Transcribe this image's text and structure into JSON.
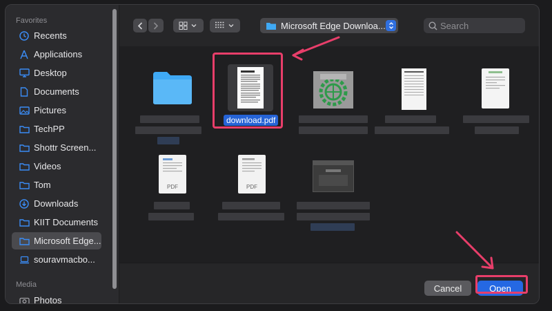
{
  "sidebar": {
    "favorites_label": "Favorites",
    "items": [
      {
        "label": "Recents",
        "icon": "clock-icon"
      },
      {
        "label": "Applications",
        "icon": "applications-icon"
      },
      {
        "label": "Desktop",
        "icon": "desktop-icon"
      },
      {
        "label": "Documents",
        "icon": "document-icon"
      },
      {
        "label": "Pictures",
        "icon": "pictures-icon"
      },
      {
        "label": "TechPP",
        "icon": "folder-icon"
      },
      {
        "label": "Shottr Screen...",
        "icon": "folder-icon"
      },
      {
        "label": "Videos",
        "icon": "folder-icon"
      },
      {
        "label": "Tom",
        "icon": "folder-icon"
      },
      {
        "label": "Downloads",
        "icon": "download-icon"
      },
      {
        "label": "KIIT Documents",
        "icon": "folder-icon"
      },
      {
        "label": "Microsoft Edge...",
        "icon": "folder-icon",
        "selected": true
      },
      {
        "label": "souravmacbo...",
        "icon": "laptop-icon"
      }
    ],
    "media_label": "Media",
    "media_items": [
      {
        "label": "Photos",
        "icon": "camera-icon"
      }
    ]
  },
  "toolbar": {
    "location_label": "Microsoft Edge Downloa...",
    "search_placeholder": "Search"
  },
  "files": {
    "selected_name": "download.pdf",
    "pdf_label": "PDF"
  },
  "actions": {
    "cancel_label": "Cancel",
    "open_label": "Open"
  },
  "colors": {
    "accent": "#2568e3",
    "highlight": "#e83e6a",
    "folder": "#3fa9f5"
  }
}
